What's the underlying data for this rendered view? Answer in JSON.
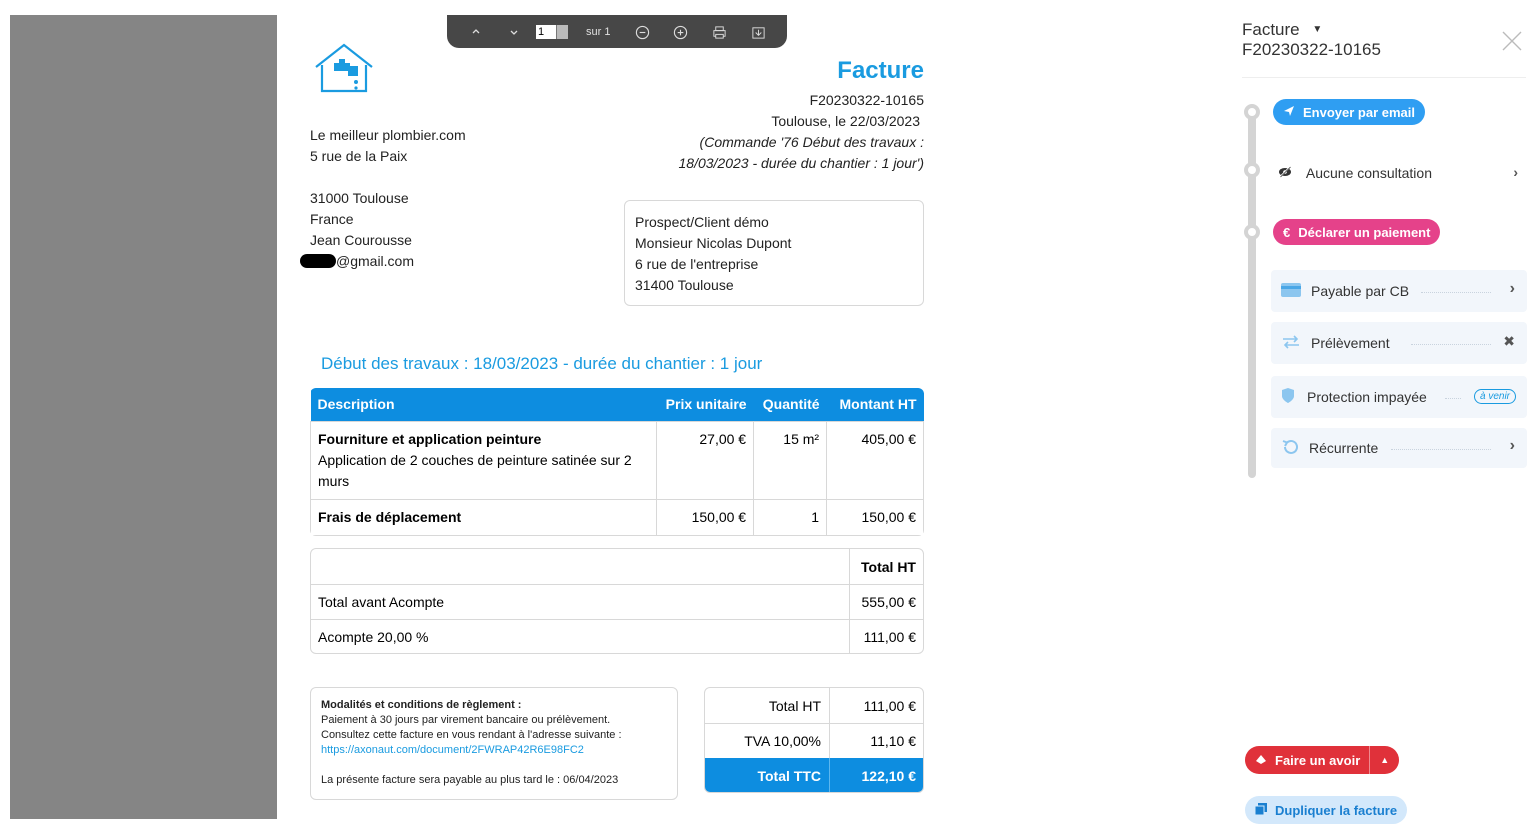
{
  "toolbar": {
    "page_value": "1",
    "page_of": "sur 1"
  },
  "invoice": {
    "title": "Facture",
    "number": "F20230322-10165",
    "place_date": "Toulouse, le 22/03/2023",
    "order_note_1": "(Commande '76 Début des travaux :",
    "order_note_2": "18/03/2023 - durée du chantier : 1 jour')",
    "sender": [
      "Le meilleur plombier.com",
      "5 rue de la Paix",
      "",
      "31000 Toulouse",
      "France",
      "Jean Courousse",
      "@gmail.com"
    ],
    "client": [
      "Prospect/Client démo",
      "Monsieur Nicolas Dupont",
      "6 rue de l'entreprise",
      "31400 Toulouse"
    ],
    "section_title": "Début des travaux : 18/03/2023 - durée du chantier : 1 jour",
    "columns": {
      "description": "Description",
      "unit_price": "Prix unitaire",
      "qty": "Quantité",
      "amount": "Montant HT"
    },
    "lines": [
      {
        "title": "Fourniture et application peinture",
        "desc": "Application de 2 couches de peinture satinée sur 2 murs",
        "unit_price": "27,00 €",
        "qty": "15 m²",
        "amount": "405,00 €"
      },
      {
        "title": "Frais de déplacement",
        "desc": "",
        "unit_price": "150,00 €",
        "qty": "1",
        "amount": "150,00 €"
      }
    ],
    "subtotal_header": "Total HT",
    "total_before_label": "Total avant Acompte",
    "total_before_value": "555,00 €",
    "deposit_label": "Acompte 20,00 %",
    "deposit_value": "111,00 €",
    "terms_title": "Modalités et conditions de règlement :",
    "terms_line1": "Paiement à 30 jours par virement bancaire ou prélèvement.",
    "terms_line2": "Consultez cette facture en vous rendant à l'adresse suivante :",
    "terms_link": "https://axonaut.com/document/2FWRAP42R6E98FC2",
    "terms_due": "La présente facture sera payable au plus tard le : 06/04/2023",
    "totals": [
      {
        "label": "Total HT",
        "value": "111,00 €"
      },
      {
        "label": "TVA 10,00%",
        "value": "11,10 €"
      },
      {
        "label": "Total TTC",
        "value": "122,10 €"
      }
    ]
  },
  "sidebar": {
    "doc_type": "Facture",
    "doc_number": "F20230322-10165",
    "send_email": "Envoyer par email",
    "consultation": "Aucune consultation",
    "declare_payment": "Déclarer un paiement",
    "options": [
      {
        "label": "Payable par CB"
      },
      {
        "label": "Prélèvement"
      },
      {
        "label": "Protection impayée",
        "badge": "à venir"
      },
      {
        "label": "Récurrente"
      }
    ],
    "credit_note": "Faire un avoir",
    "duplicate": "Dupliquer la facture"
  },
  "colors": {
    "accent": "#1a9be0",
    "table_header": "#0d8de0",
    "email_pill": "#2f9ef2",
    "payment_pill": "#e5428a",
    "credit_pill": "#e0313a"
  }
}
